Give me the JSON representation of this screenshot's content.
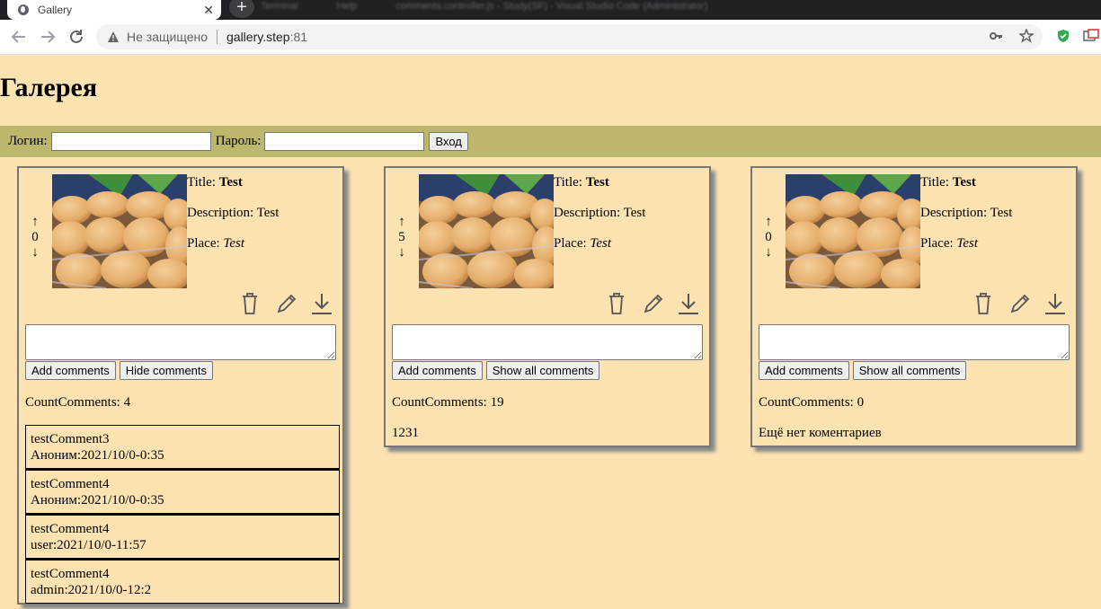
{
  "browser": {
    "tab_title": "Gallery",
    "tab_close": "✕",
    "new_tab": "+",
    "background_tabs": [
      "Terminal",
      "Help",
      "comments.controller.js - Study(SF) - Visual Studio Code (Administrator)"
    ],
    "security_label": "Не защищено",
    "url_host": "gallery.step",
    "url_port": ":81"
  },
  "page": {
    "title": "Галерея"
  },
  "login": {
    "login_label": "Логин:",
    "password_label": "Пароль:",
    "submit_label": "Вход"
  },
  "cards": [
    {
      "up": "↑",
      "rating": "0",
      "down": "↓",
      "title_label": "Title:",
      "title": "Test",
      "description_label": "Description:",
      "description": "Test",
      "place_label": "Place:",
      "place": "Test",
      "add_label": "Add comments",
      "toggle_label": "Hide comments",
      "count_label": "CountComments:",
      "count": "4",
      "comments": [
        {
          "text": "testComment3",
          "meta": "Аноним:2021/10/0-0:35"
        },
        {
          "text": "testComment4",
          "meta": "Аноним:2021/10/0-0:35"
        },
        {
          "text": "testComment4",
          "meta": "user:2021/10/0-11:57"
        },
        {
          "text": "testComment4",
          "meta": "admin:2021/10/0-12:2"
        }
      ]
    },
    {
      "up": "↑",
      "rating": "5",
      "down": "↓",
      "title_label": "Title:",
      "title": "Test",
      "description_label": "Description:",
      "description": "Test",
      "place_label": "Place:",
      "place": "Test",
      "add_label": "Add comments",
      "toggle_label": "Show all comments",
      "count_label": "CountComments:",
      "count": "19",
      "extra": "1231"
    },
    {
      "up": "↑",
      "rating": "0",
      "down": "↓",
      "title_label": "Title:",
      "title": "Test",
      "description_label": "Description:",
      "description": "Test",
      "place_label": "Place:",
      "place": "Test",
      "add_label": "Add comments",
      "toggle_label": "Show all comments",
      "count_label": "CountComments:",
      "count": "0",
      "extra": "Ещё нет коментариев"
    }
  ],
  "colors": {
    "page_bg": "#fde3b1",
    "login_bar": "#bdb76b",
    "card_border": "#777777"
  }
}
